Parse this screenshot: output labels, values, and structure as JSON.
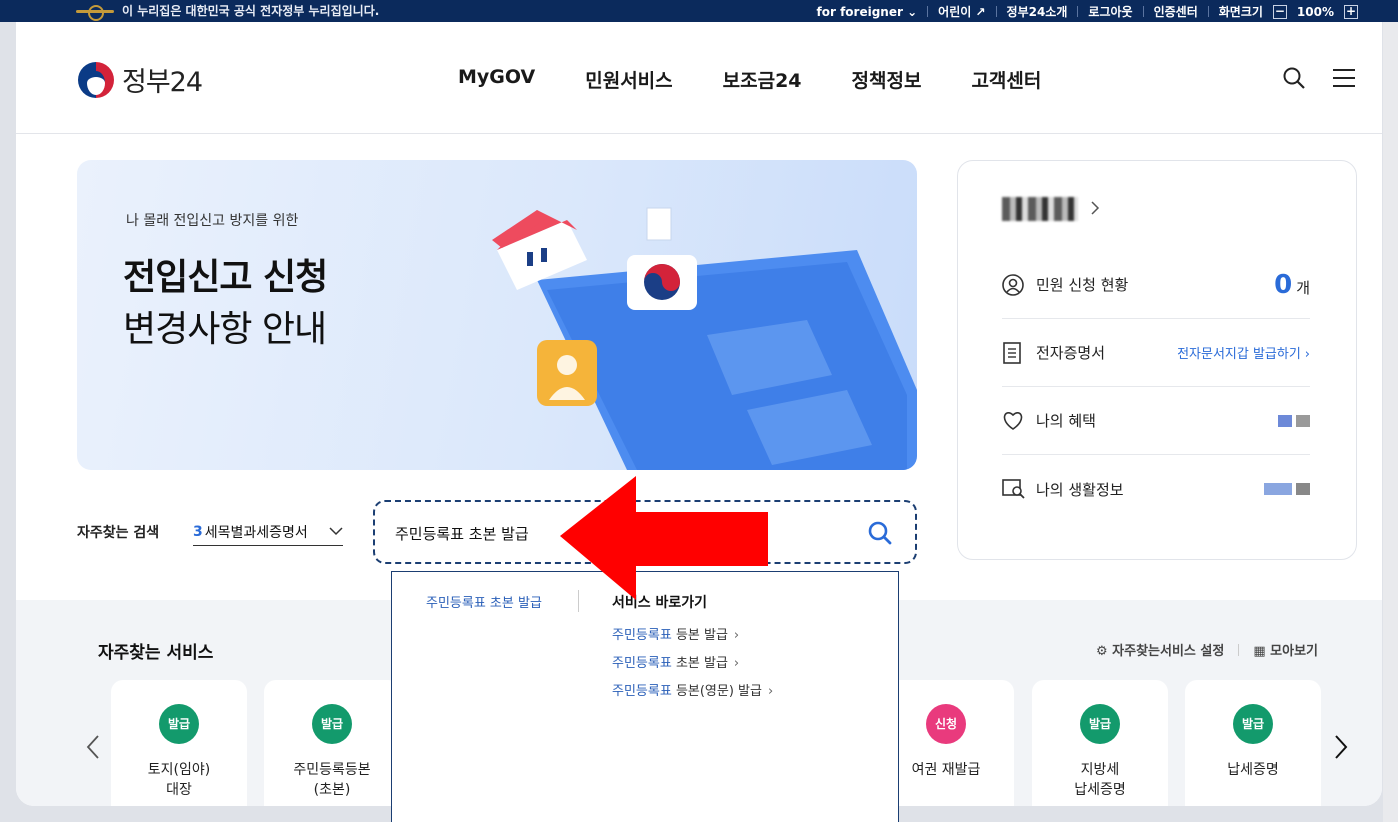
{
  "topbar": {
    "gov_notice": "이 누리집은 대한민국 공식 전자정부 누리집입니다.",
    "links": [
      "for foreigner",
      "어린이",
      "정부24소개",
      "로그아웃",
      "인증센터",
      "화면크기"
    ],
    "zoom_minus": "−",
    "zoom_level": "100%",
    "zoom_plus": "+"
  },
  "header": {
    "logo_text": "정부24",
    "nav": [
      "MyGOV",
      "민원서비스",
      "보조금24",
      "정책정보",
      "고객센터"
    ]
  },
  "banner": {
    "subtitle": "나 몰래 전입신고 방지를 위한",
    "title_line1": "전입신고 신청",
    "title_line2": "변경사항 안내"
  },
  "user_panel": {
    "rows": {
      "applications_label": "민원 신청 현황",
      "applications_count": "0",
      "applications_unit": "개",
      "certificates_label": "전자증명서",
      "certificates_link": "전자문서지갑 발급하기",
      "benefits_label": "나의 혜택",
      "lifeinfo_label": "나의 생활정보"
    }
  },
  "search": {
    "freq_label": "자주찾는 검색",
    "freq_num": "3",
    "freq_text": "세목별과세증명서",
    "query": "주민등록표 초본 발급"
  },
  "autocomplete": {
    "suggestion": "주민등록표 초본 발급",
    "shortcut_header": "서비스 바로가기",
    "items": [
      {
        "kw": "주민등록표",
        "rest": " 등본 발급"
      },
      {
        "kw": "주민등록표",
        "rest": " 초본 발급"
      },
      {
        "kw": "주민등록표",
        "rest": " 등본(영문) 발급"
      }
    ]
  },
  "services": {
    "title": "자주찾는 서비스",
    "settings_label": "자주찾는서비스 설정",
    "collect_label": "모아보기",
    "tiles": [
      {
        "badge": "발급",
        "label": "토지(임야)\n대장"
      },
      {
        "badge": "발급",
        "label": "주민등록등본\n(초본)"
      },
      {
        "badge": "신청",
        "label": "여권 재발급"
      },
      {
        "badge": "발급",
        "label": "지방세\n납세증명"
      },
      {
        "badge": "발급",
        "label": "납세증명"
      }
    ]
  },
  "colors": {
    "navy": "#0b2a5c",
    "accent_blue": "#2a6bd8",
    "issue_green": "#139a6c",
    "apply_pink": "#e93a7d",
    "arrow_red": "#ff0000"
  }
}
